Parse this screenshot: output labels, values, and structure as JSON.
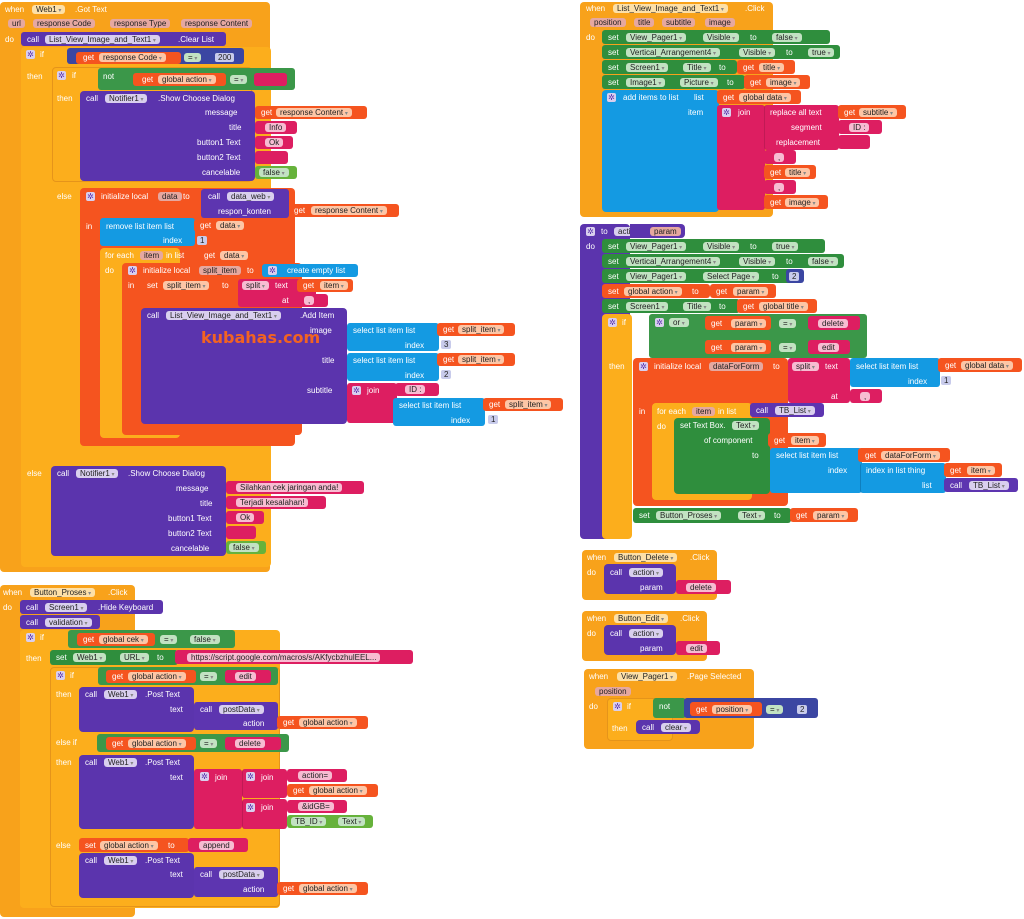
{
  "watermark": "kubahas.com",
  "kw": {
    "when": "when",
    "do": "do",
    "if": "if",
    "then": "then",
    "else": "else",
    "else_if": "else if",
    "call": "call",
    "get": "get",
    "set": "set",
    "to": "to",
    "not": "not",
    "or": "or",
    "join": "join",
    "in": "in",
    "for_each": "for each",
    "in_list": "in list",
    "item": "item",
    "index": "index",
    "list": "list",
    "eq": "=",
    "at": "at",
    "text": "text"
  },
  "got_text": {
    "component": "Web1",
    "event": ".Got Text",
    "params": [
      "url",
      "response Code",
      "response Type",
      "response Content"
    ],
    "clear_target": "List_View_Image_and_Text1",
    "clear_method": ".Clear List",
    "cond_var": "response Code",
    "cond_value": "200",
    "inner_var": "global action",
    "notifier": "Notifier1",
    "dialog_method": ".Show Choose Dialog",
    "dialog_labels": [
      "message",
      "title",
      "button1 Text",
      "button2 Text",
      "cancelable"
    ],
    "dialog1": {
      "message": "response Content",
      "title": "Info",
      "b1": "Ok",
      "b2": "",
      "cancelable": "false"
    },
    "init_local": "initialize local",
    "local_data": "data",
    "data_web": "data_web",
    "respon_konten": "respon_konten",
    "resp_content": "response Content",
    "remove_list_item": "remove list item  list",
    "idx1": "1",
    "split_item": "split_item",
    "create_empty_list": "create empty list",
    "split": "split",
    "sep": ",",
    "add_item_method": ".Add Item",
    "add_labels": [
      "image",
      "title",
      "subtitle"
    ],
    "select_list_item": "select list item  list",
    "idx3": "3",
    "idx2": "2",
    "id_prefix": "ID : ",
    "dialog2": {
      "message": "Silahkan cek jaringan anda!",
      "title": "Terjadi kesalahan!",
      "b1": "Ok",
      "b2": "",
      "cancelable": "false"
    }
  },
  "proses_click": {
    "component": "Button_Proses",
    "event": ".Click",
    "screen": "Screen1",
    "hide_kb": ".Hide Keyboard",
    "validation": "validation",
    "cek_var": "global cek",
    "false_val": "false",
    "web": "Web1",
    "url_prop": "URL",
    "url_value": "https://script.google.com/macros/s/AKfycbzhulEEL...",
    "action_var": "global action",
    "edit": "edit",
    "delete": "delete",
    "append": "append",
    "post_text": ".Post Text",
    "post_data": "postData",
    "action_label": "action",
    "action_eq": "action=",
    "idgb": "&idGB=",
    "tb_id": "TB_ID",
    "text_prop": "Text"
  },
  "list_click": {
    "component": "List_View_Image_and_Text1",
    "event": ".Click",
    "params": [
      "position",
      "title",
      "subtitle",
      "image"
    ],
    "sets": [
      {
        "comp": "View_Pager1",
        "prop": "Visible",
        "val": "false"
      },
      {
        "comp": "Vertical_Arrangement4",
        "prop": "Visible",
        "val": "true"
      },
      {
        "comp": "Screen1",
        "prop": "Title",
        "val": "title"
      },
      {
        "comp": "Image1",
        "prop": "Picture",
        "val": "image"
      }
    ],
    "add_items": "add items to list",
    "global_data": "global data",
    "replace_all": "replace all text",
    "segment": "segment",
    "replacement": "replacement",
    "subtitle": "subtitle",
    "seg_val": "ID : ",
    "rep_val": "",
    "sep_val": ",",
    "title": "title",
    "image": "image"
  },
  "action_proc": {
    "name": "action",
    "param": "param",
    "sets": [
      {
        "comp": "View_Pager1",
        "prop": "Visible",
        "val": "true"
      },
      {
        "comp": "Vertical_Arrangement4",
        "prop": "Visible",
        "val": "false"
      },
      {
        "comp": "View_Pager1",
        "prop": "Select Page",
        "val": "2"
      }
    ],
    "global_action": "global action",
    "screen": "Screen1",
    "title_prop": "Title",
    "global_title": "global title",
    "delete": "delete",
    "edit": "edit",
    "init_local": "initialize local",
    "data_for_form": "dataForForm",
    "global_data": "global data",
    "sep": ",",
    "tb_list": "TB_List",
    "set_textbox": "set Text Box.",
    "text_prop": "Text",
    "of_component": "of component",
    "index_in_list": "index in list  thing",
    "button_proses": "Button_Proses"
  },
  "delete_click": {
    "component": "Button_Delete",
    "event": ".Click",
    "proc": "action",
    "param_label": "param",
    "val": "delete"
  },
  "edit_click": {
    "component": "Button_Edit",
    "event": ".Click",
    "proc": "action",
    "param_label": "param",
    "val": "edit"
  },
  "pager_selected": {
    "component": "View_Pager1",
    "event": ".Page Selected",
    "param": "position",
    "var": "position",
    "value": "2",
    "proc": "clear"
  }
}
